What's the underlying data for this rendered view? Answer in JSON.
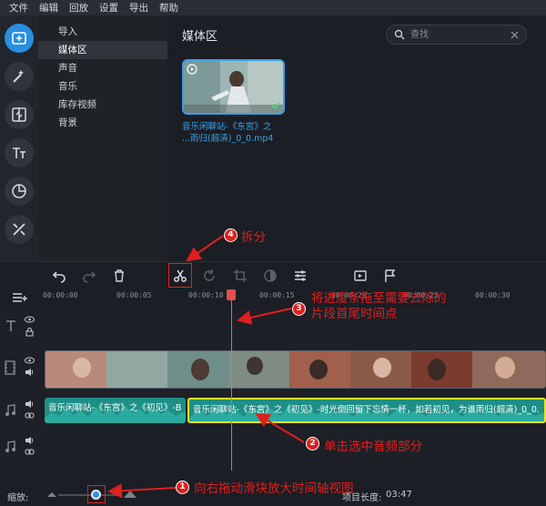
{
  "menu": [
    "文件",
    "编辑",
    "回放",
    "设置",
    "导出",
    "帮助"
  ],
  "left_tools": [
    {
      "icon": "import-media-icon",
      "active": true
    },
    {
      "icon": "magic-wand-icon",
      "active": false
    },
    {
      "icon": "transitions-icon",
      "active": false
    },
    {
      "icon": "titles-icon",
      "active": false
    },
    {
      "icon": "stickers-icon",
      "active": false
    },
    {
      "icon": "more-tools-icon",
      "active": false
    }
  ],
  "categories": [
    {
      "label": "导入",
      "active": false
    },
    {
      "label": "媒体区",
      "active": true
    },
    {
      "label": "声音",
      "active": false
    },
    {
      "label": "音乐",
      "active": false
    },
    {
      "label": "库存视频",
      "active": false
    },
    {
      "label": "背景",
      "active": false
    }
  ],
  "media": {
    "title": "媒体区",
    "search_placeholder": "查找",
    "clip_name_line1": "音乐闲聊站-《东宫》之",
    "clip_name_line2": "...雨归(超清)_0_0.mp4"
  },
  "ruler": [
    "00:00:00",
    "00:00:05",
    "00:00:10",
    "00:00:15",
    "00:00:20",
    "00:00:25",
    "00:00:30"
  ],
  "audio_clips": [
    {
      "label": "音乐闲聊站-《东宫》之《初见》-B"
    },
    {
      "label": "音乐闲聊站-《东宫》之《初见》-时光倒回留下忘情一杯，如若初见，为谁雨归(超清)_0_0."
    }
  ],
  "bottom": {
    "zoom_label": "缩放:",
    "project_length_label": "项目长度:",
    "project_length": "03:47"
  },
  "annotations": {
    "a1": {
      "num": "1",
      "text": "向右拖动滑块放大时间轴视图"
    },
    "a2": {
      "num": "2",
      "text": "单击选中音频部分"
    },
    "a3": {
      "num": "3",
      "line1": "将进度条拖至需要去除的",
      "line2": "片段首尾时间点"
    },
    "a4": {
      "num": "4",
      "text": "拆分"
    }
  },
  "colors": {
    "accent_blue": "#3ba0e8",
    "annotation_red": "#e01f1f",
    "audio_clip": "#1e8f86",
    "selection_yellow": "#f0e020"
  }
}
